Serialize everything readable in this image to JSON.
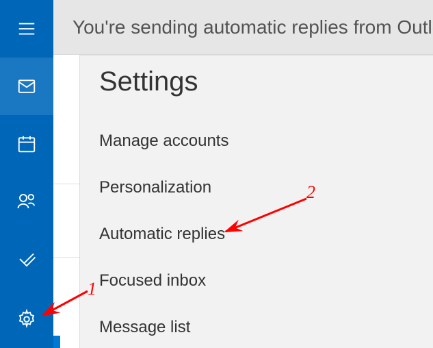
{
  "topbar": {
    "message": "You're sending automatic replies from Outlook"
  },
  "sidebar": {
    "items": [
      {
        "name": "hamburger"
      },
      {
        "name": "mail",
        "active": true
      },
      {
        "name": "calendar"
      },
      {
        "name": "people"
      },
      {
        "name": "todo"
      },
      {
        "name": "settings"
      }
    ]
  },
  "settings": {
    "title": "Settings",
    "items": [
      "Manage accounts",
      "Personalization",
      "Automatic replies",
      "Focused inbox",
      "Message list"
    ]
  },
  "annotations": {
    "label1": "1",
    "label2": "2"
  },
  "colors": {
    "sidebar_bg": "#0067b8",
    "panel_bg": "#f2f2f2",
    "accent": "#0078d4",
    "annotation": "#ff0000"
  }
}
